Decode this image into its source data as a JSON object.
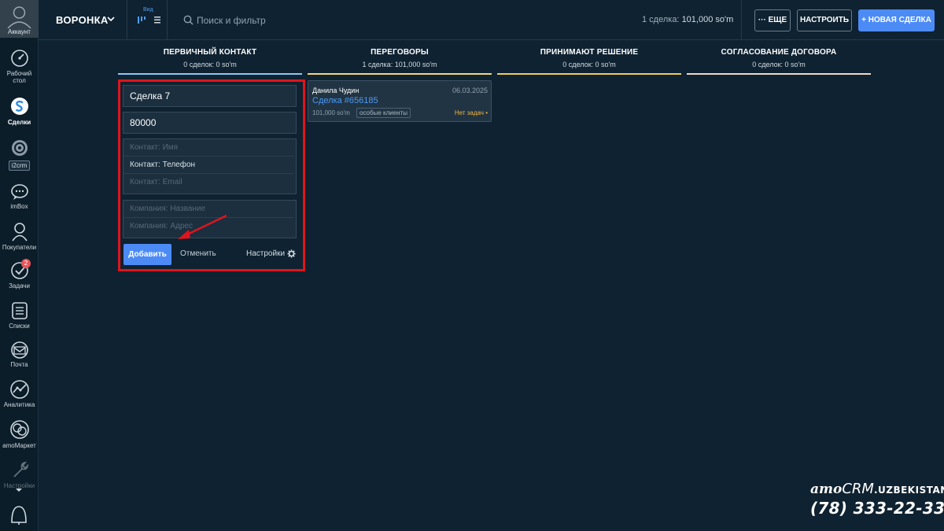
{
  "sidebar": {
    "account": "Аккаунт",
    "items": [
      {
        "label": "Рабочий стол",
        "label_line1": "Рабочий",
        "label_line2": "стол",
        "icon": "speedometer-icon"
      },
      {
        "label": "Сделки",
        "icon": "deals-icon"
      },
      {
        "label": "i2crm",
        "icon": "i2crm-icon"
      },
      {
        "label": "imBox",
        "icon": "chat-icon"
      },
      {
        "label": "Покупатели",
        "icon": "customers-icon"
      },
      {
        "label": "Задачи",
        "icon": "tasks-icon",
        "badge": "2"
      },
      {
        "label": "Списки",
        "icon": "lists-icon"
      },
      {
        "label": "Почта",
        "icon": "mail-icon"
      },
      {
        "label": "Аналитика",
        "icon": "analytics-icon"
      },
      {
        "label": "amoМаркет",
        "icon": "market-icon"
      },
      {
        "label": "Настройки",
        "icon": "settings-icon"
      }
    ]
  },
  "topbar": {
    "pipeline": "ВОРОНКА",
    "view_label": "Вид",
    "search_placeholder": "Поиск и фильтр",
    "deal_count": "1 сделка:",
    "deal_total": "101,000 so'm",
    "more": "ЕЩЕ",
    "setup": "НАСТРОИТЬ",
    "new_deal": "НОВАЯ СДЕЛКА",
    "new_deal_prefix": "+"
  },
  "columns": [
    {
      "name": "ПЕРВИЧНЫЙ КОНТАКТ",
      "summary": "0 сделок: 0 so'm",
      "color": "#8fc7f4"
    },
    {
      "name": "ПЕРЕГОВОРЫ",
      "summary": "1 сделка: 101,000 so'm",
      "color": "#f2d77b"
    },
    {
      "name": "ПРИНИМАЮТ РЕШЕНИЕ",
      "summary": "0 сделок: 0 so'm",
      "color": "#f3c95b"
    },
    {
      "name": "СОГЛАСОВАНИЕ ДОГОВОРА",
      "summary": "0 сделок: 0 so'm",
      "color": "#f0d9cc"
    }
  ],
  "quick_add": {
    "deal_name": "Сделка 7",
    "price": "80000",
    "contact_name_placeholder": "Контакт: Имя",
    "contact_phone": "Контакт: Телефон",
    "contact_email_placeholder": "Контакт: Email",
    "company_name_placeholder": "Компания: Название",
    "company_address_placeholder": "Компания: Адрес",
    "add": "Добавить",
    "cancel": "Отменить",
    "settings": "Настройки"
  },
  "card": {
    "contact": "Данила Чудин",
    "date": "06.03.2025",
    "name": "Сделка #656185",
    "price": "101,000 so'm",
    "tag": "особые клиенты",
    "task": "Нет задач"
  },
  "watermark": {
    "brand_amo": "amo",
    "brand_crm": "CRM",
    "brand_tld": ".UZBEKISTAN",
    "phone": "(78) 333-22-33"
  },
  "colors": {
    "background": "#0f2231",
    "sidebar": "#0b1d29",
    "accent": "#4c8bf5",
    "highlight_frame": "#e0141c",
    "task_warning": "#f2b544"
  }
}
